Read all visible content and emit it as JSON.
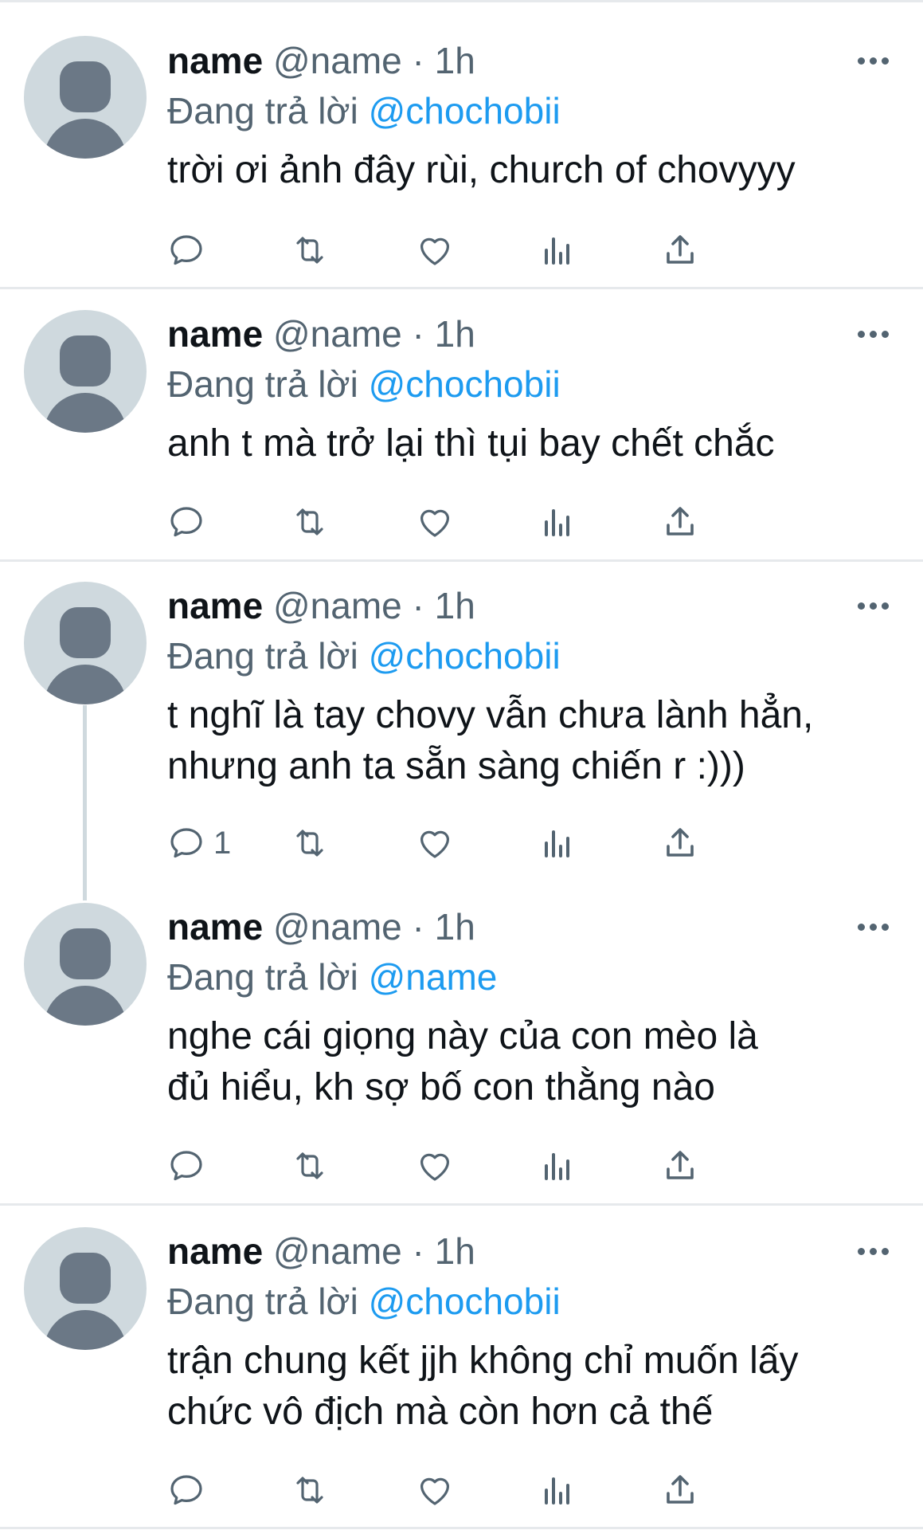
{
  "colors": {
    "accent": "#1d9bf0",
    "secondary_text": "#536471",
    "avatar_bg": "#cfd9de",
    "avatar_fg": "#6b7886"
  },
  "tweets": [
    {
      "name": "name",
      "handle": "@name",
      "separator": "·",
      "time": "1h",
      "reply_prefix": "Đang trả lời",
      "reply_to": "@chochobii",
      "text": "trời ơi ảnh đây rùi, church of chovyyy",
      "reply_count": ""
    },
    {
      "name": "name",
      "handle": "@name",
      "separator": "·",
      "time": "1h",
      "reply_prefix": "Đang trả lời",
      "reply_to": "@chochobii",
      "text": "anh t mà trở lại thì tụi bay chết chắc",
      "reply_count": ""
    },
    {
      "name": "name",
      "handle": "@name",
      "separator": "·",
      "time": "1h",
      "reply_prefix": "Đang trả lời",
      "reply_to": "@chochobii",
      "text": "t nghĩ là tay chovy vẫn chưa lành hẳn,\nnhưng anh ta sẵn sàng chiến r :)))",
      "reply_count": "1"
    },
    {
      "name": "name",
      "handle": "@name",
      "separator": "·",
      "time": "1h",
      "reply_prefix": "Đang trả lời",
      "reply_to": "@name",
      "text": "nghe cái giọng này của con mèo là\nđủ hiểu, kh sợ bố con thằng nào",
      "reply_count": ""
    },
    {
      "name": "name",
      "handle": "@name",
      "separator": "·",
      "time": "1h",
      "reply_prefix": "Đang trả lời",
      "reply_to": "@chochobii",
      "text": "trận chung kết jjh không chỉ muốn lấy\nchức vô địch mà còn hơn cả thế",
      "reply_count": ""
    }
  ],
  "icons": {
    "reply": "reply-icon",
    "retweet": "retweet-icon",
    "like": "heart-icon",
    "views": "views-icon",
    "share": "share-icon",
    "more": "more-icon"
  }
}
